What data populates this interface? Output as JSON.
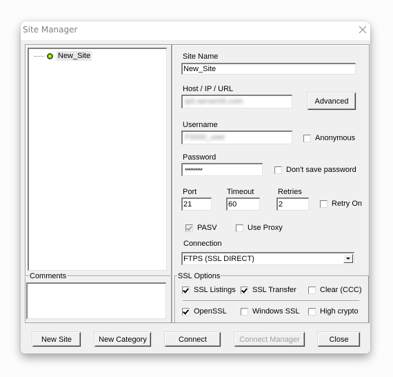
{
  "window": {
    "title": "Site Manager",
    "close_icon": "close-icon"
  },
  "tree": {
    "items": [
      {
        "label": "New_Site",
        "icon": "site-node-icon",
        "selected": true
      }
    ]
  },
  "comments": {
    "label": "Comments",
    "value": ""
  },
  "form": {
    "site_name": {
      "label": "Site Name",
      "value": "New_Site"
    },
    "host": {
      "label": "Host / IP / URL",
      "value": "ip0.server00.com"
    },
    "advanced_button": "Advanced",
    "username": {
      "label": "Username",
      "value": "F0000_user"
    },
    "anonymous": {
      "label": "Anonymous",
      "checked": false
    },
    "password": {
      "label": "Password",
      "value": "**********"
    },
    "dont_save_password": {
      "label": "Don't save password",
      "checked": false
    },
    "port": {
      "label": "Port",
      "value": "21"
    },
    "timeout": {
      "label": "Timeout",
      "value": "60"
    },
    "retries": {
      "label": "Retries",
      "value": "2"
    },
    "retry_on": {
      "label": "Retry On",
      "checked": false
    },
    "pasv": {
      "label": "PASV",
      "checked": true,
      "disabled": true
    },
    "use_proxy": {
      "label": "Use Proxy",
      "checked": false
    },
    "connection": {
      "label": "Connection",
      "value": "FTPS (SSL DIRECT)"
    }
  },
  "ssl_options": {
    "label": "SSL Options",
    "ssl_listings": {
      "label": "SSL Listings",
      "checked": true
    },
    "ssl_transfer": {
      "label": "SSL Transfer",
      "checked": true
    },
    "clear_ccc": {
      "label": "Clear (CCC)",
      "checked": false
    },
    "openssl": {
      "label": "OpenSSL",
      "checked": true
    },
    "windows_ssl": {
      "label": "Windows SSL",
      "checked": false
    },
    "high_crypto": {
      "label": "High crypto",
      "checked": false
    }
  },
  "buttons": {
    "new_site": "New Site",
    "new_category": "New Category",
    "connect": "Connect",
    "connect_manager": "Connect Manager",
    "close": "Close"
  }
}
